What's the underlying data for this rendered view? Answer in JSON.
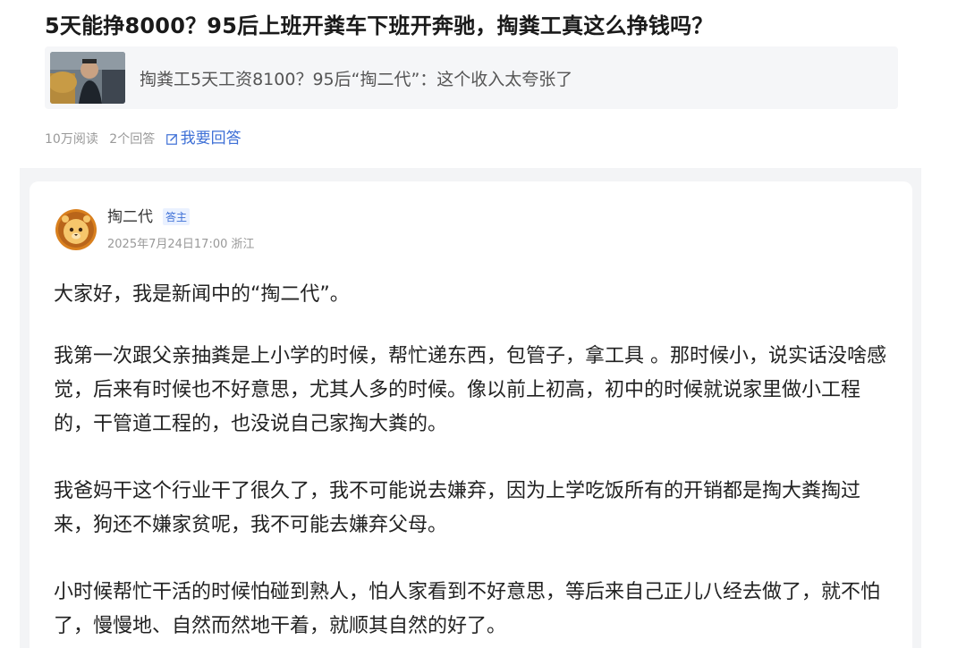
{
  "question": {
    "title": "5天能挣8000？95后上班开粪车下班开奔驰，掏粪工真这么挣钱吗？"
  },
  "related_article": {
    "title": "掏粪工5天工资8100？95后“掏二代”：这个收入太夸张了"
  },
  "stats": {
    "reads": "10万阅读",
    "answers": "2个回答",
    "answer_link": "我要回答"
  },
  "answer": {
    "author": "掏二代",
    "badge": "答主",
    "time": "2025年7月24日17:00",
    "location": "浙江",
    "paragraphs": [
      "大家好，我是新闻中的“掏二代”。",
      "我第一次跟父亲抽粪是上小学的时候，帮忙递东西，包管子，拿工具 。那时候小，说实话没啥感觉，后来有时候也不好意思，尤其人多的时候。像以前上初高，初中的时候就说家里做小工程的，干管道工程的，也没说自己家掏大粪的。",
      "我爸妈干这个行业干了很久了，我不可能说去嫌弃，因为上学吃饭所有的开销都是掏大粪掏过来，狗还不嫌家贫呢，我不可能去嫌弃父母。",
      "小时候帮忙干活的时候怕碰到熟人，怕人家看到不好意思，等后来自己正儿八经去做了，就不怕了，慢慢地、自然而然地干着，就顺其自然的好了。"
    ]
  },
  "colors": {
    "link": "#3d6fd6",
    "muted": "#999999",
    "panel": "#f5f6f8"
  },
  "icons": {
    "edit": "edit-icon",
    "avatar": "lion-avatar-icon",
    "thumbnail": "worker-photo-thumbnail"
  }
}
